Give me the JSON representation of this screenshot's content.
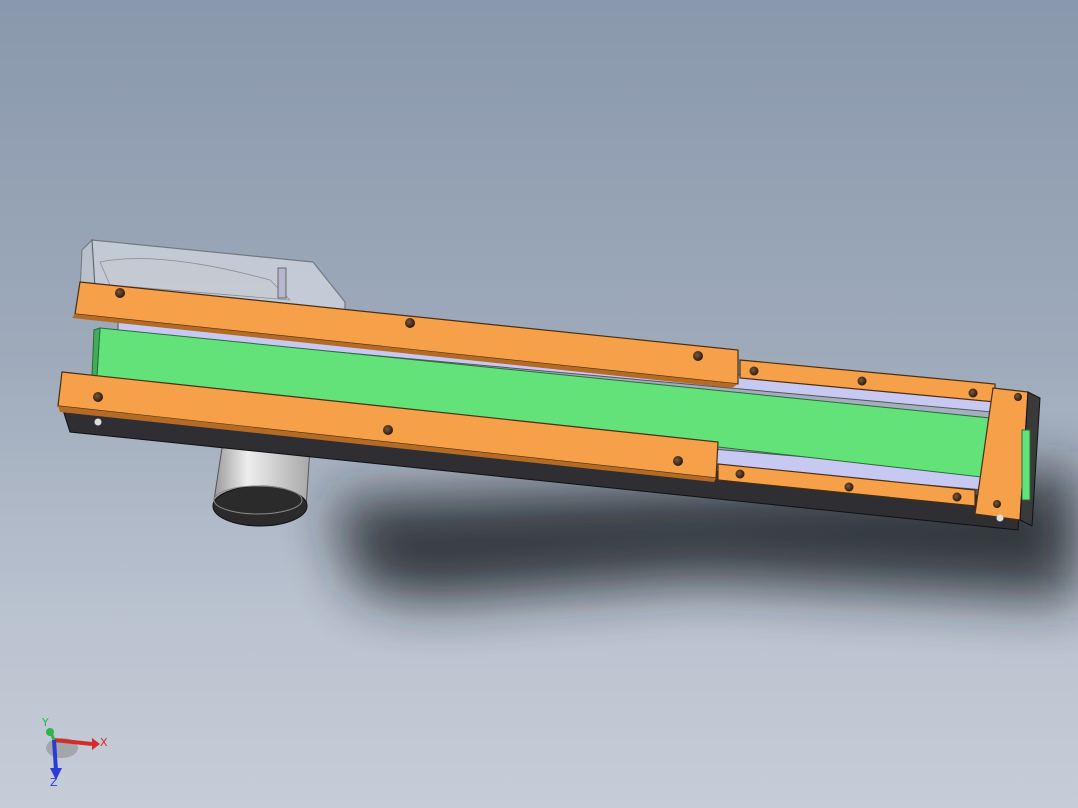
{
  "viewport": {
    "background_top": "#8a98ad",
    "background_bottom": "#c6cdd8"
  },
  "model": {
    "frame_color": "#f7a04a",
    "belt_color": "#63e27a",
    "rail_color": "#c7c9f2",
    "cover_color": "#e6e9ef",
    "motor_color": "#d8d8d8",
    "screw_icon": "socket-head-screw-icon"
  },
  "triad": {
    "x_label": "X",
    "y_label": "Y",
    "z_label": "Z",
    "x_color": "#d62b2b",
    "y_color": "#2bb54a",
    "z_color": "#2b3bd6"
  }
}
